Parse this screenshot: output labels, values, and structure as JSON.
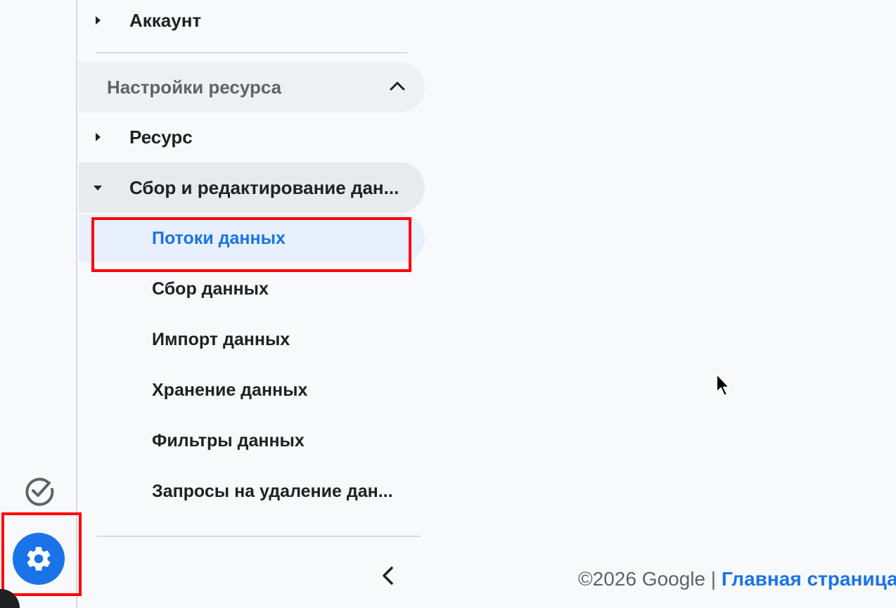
{
  "nav": {
    "account_label": "Аккаунт",
    "section_title": "Настройки ресурса",
    "property_label": "Ресурс",
    "data_collection_label": "Сбор и редактирование дан...",
    "sub_items": [
      "Потоки данных",
      "Сбор данных",
      "Импорт данных",
      "Хранение данных",
      "Фильтры данных",
      "Запросы на удаление дан..."
    ]
  },
  "footer": {
    "copyright": "©2026 Google | ",
    "home_link": "Главная страница"
  },
  "icons": {
    "check": "check-circle-icon",
    "settings": "gear-icon",
    "collapse": "chevron-left-icon"
  },
  "colors": {
    "accent": "#1a73e8",
    "highlight": "#ff0000"
  }
}
